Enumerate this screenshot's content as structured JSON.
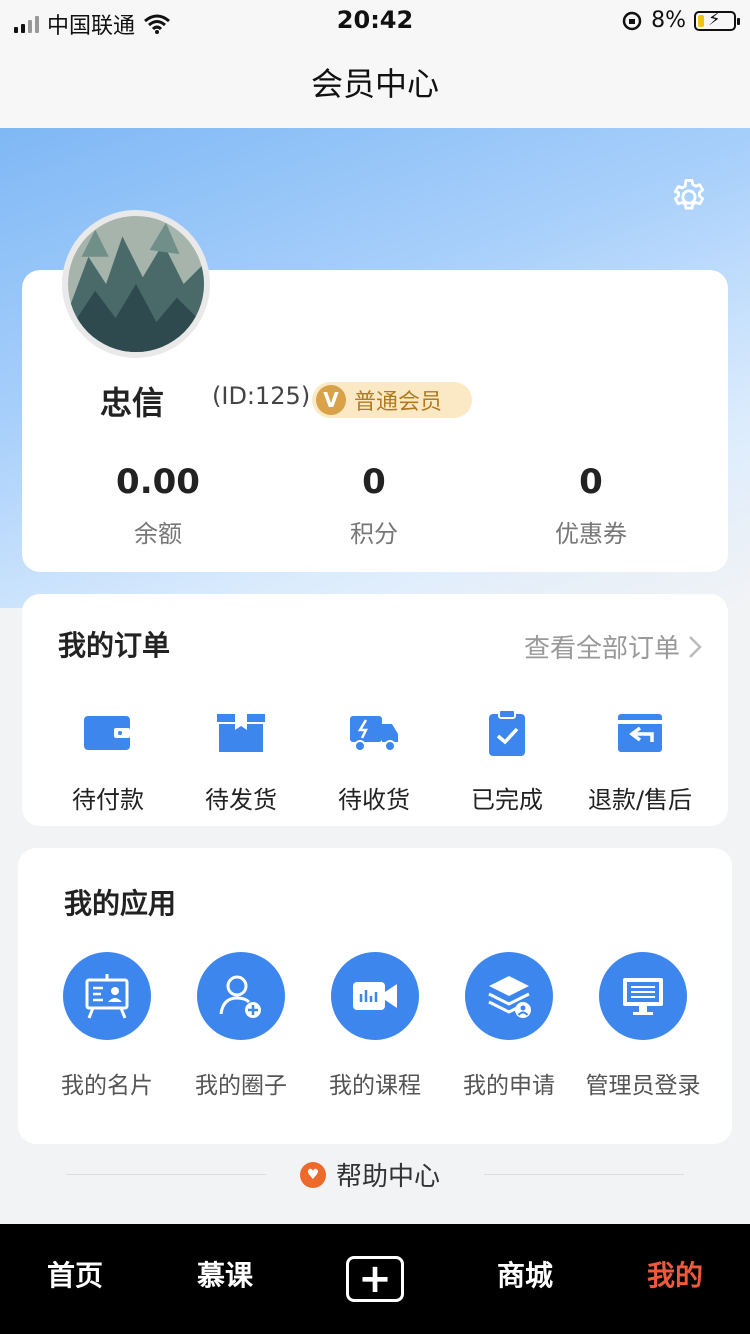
{
  "status_bar": {
    "carrier": "中国联通",
    "time": "20:42",
    "battery": "8%"
  },
  "nav": {
    "title": "会员中心"
  },
  "profile": {
    "name": "忠信",
    "id_text": "(ID:125)",
    "member_level": "普通会员",
    "stats": [
      {
        "value": "0.00",
        "label": "余额"
      },
      {
        "value": "0",
        "label": "积分"
      },
      {
        "value": "0",
        "label": "优惠券"
      }
    ]
  },
  "orders": {
    "title": "我的订单",
    "view_all": "查看全部订单",
    "items": [
      {
        "label": "待付款",
        "icon": "wallet-icon"
      },
      {
        "label": "待发货",
        "icon": "box-icon"
      },
      {
        "label": "待收货",
        "icon": "truck-icon"
      },
      {
        "label": "已完成",
        "icon": "clipboard-check-icon"
      },
      {
        "label": "退款/售后",
        "icon": "return-icon"
      }
    ]
  },
  "apps": {
    "title": "我的应用",
    "items": [
      {
        "label": "我的名片",
        "icon": "business-card-icon"
      },
      {
        "label": "我的圈子",
        "icon": "user-add-icon"
      },
      {
        "label": "我的课程",
        "icon": "video-course-icon"
      },
      {
        "label": "我的申请",
        "icon": "layers-user-icon"
      },
      {
        "label": "管理员登录",
        "icon": "monitor-icon"
      }
    ]
  },
  "help": {
    "label": "帮助中心"
  },
  "tabbar": {
    "tabs": [
      {
        "label": "首页"
      },
      {
        "label": "慕课"
      },
      {
        "label": ""
      },
      {
        "label": "商城"
      },
      {
        "label": "我的"
      }
    ],
    "active_color": "#ef5a3b"
  },
  "colors": {
    "accent": "#3d86ee",
    "gold_badge": "#fbe9c6",
    "active_tab": "#ef5a3b"
  }
}
